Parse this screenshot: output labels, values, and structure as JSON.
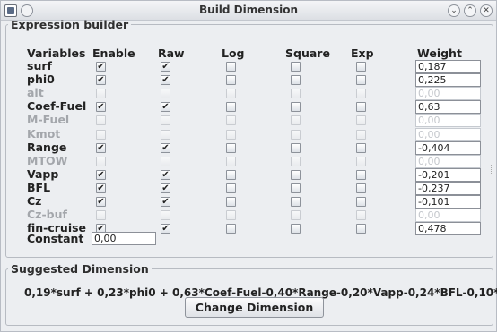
{
  "window": {
    "title": "Build Dimension",
    "controls": [
      "minimize",
      "maximize",
      "close"
    ]
  },
  "expression_builder": {
    "legend": "Expression builder",
    "headers": {
      "variables": "Variables",
      "enable": "Enable",
      "raw": "Raw",
      "log": "Log",
      "square": "Square",
      "exp": "Exp",
      "weight": "Weight"
    },
    "rows": [
      {
        "name": "surf",
        "enabled": true,
        "enable": true,
        "raw": true,
        "log": false,
        "square": false,
        "exp": false,
        "weight": "0,187"
      },
      {
        "name": "phi0",
        "enabled": true,
        "enable": true,
        "raw": true,
        "log": false,
        "square": false,
        "exp": false,
        "weight": "0,225"
      },
      {
        "name": "alt",
        "enabled": false,
        "enable": false,
        "raw": false,
        "log": false,
        "square": false,
        "exp": false,
        "weight": "0,00"
      },
      {
        "name": "Coef-Fuel",
        "enabled": true,
        "enable": true,
        "raw": true,
        "log": false,
        "square": false,
        "exp": false,
        "weight": "0,63"
      },
      {
        "name": "M-Fuel",
        "enabled": false,
        "enable": false,
        "raw": false,
        "log": false,
        "square": false,
        "exp": false,
        "weight": "0,00"
      },
      {
        "name": "Kmot",
        "enabled": false,
        "enable": false,
        "raw": false,
        "log": false,
        "square": false,
        "exp": false,
        "weight": "0,00"
      },
      {
        "name": "Range",
        "enabled": true,
        "enable": true,
        "raw": true,
        "log": false,
        "square": false,
        "exp": false,
        "weight": "-0,404"
      },
      {
        "name": "MTOW",
        "enabled": false,
        "enable": false,
        "raw": false,
        "log": false,
        "square": false,
        "exp": false,
        "weight": "0,00"
      },
      {
        "name": "Vapp",
        "enabled": true,
        "enable": true,
        "raw": true,
        "log": false,
        "square": false,
        "exp": false,
        "weight": "-0,201"
      },
      {
        "name": "BFL",
        "enabled": true,
        "enable": true,
        "raw": true,
        "log": false,
        "square": false,
        "exp": false,
        "weight": "-0,237"
      },
      {
        "name": "Cz",
        "enabled": true,
        "enable": true,
        "raw": true,
        "log": false,
        "square": false,
        "exp": false,
        "weight": "-0,101"
      },
      {
        "name": "Cz-buf",
        "enabled": false,
        "enable": false,
        "raw": false,
        "log": false,
        "square": false,
        "exp": false,
        "weight": "0,00"
      },
      {
        "name": "fin-cruise",
        "enabled": true,
        "enable": true,
        "raw": true,
        "log": false,
        "square": false,
        "exp": false,
        "weight": "0,478"
      }
    ],
    "constant": {
      "label": "Constant",
      "value": "0,00"
    }
  },
  "suggested": {
    "legend": "Suggested Dimension",
    "formula": "0,19*surf + 0,23*phi0 + 0,63*Coef-Fuel-0,40*Range-0,20*Vapp-0,24*BFL-0,10*...",
    "button_label": "Change Dimension"
  },
  "icons": {
    "app": "app-icon",
    "menu": "window-menu-icon",
    "minimize": "chevron-down-icon",
    "maximize": "chevron-up-icon",
    "close": "close-icon",
    "check": "✔"
  }
}
